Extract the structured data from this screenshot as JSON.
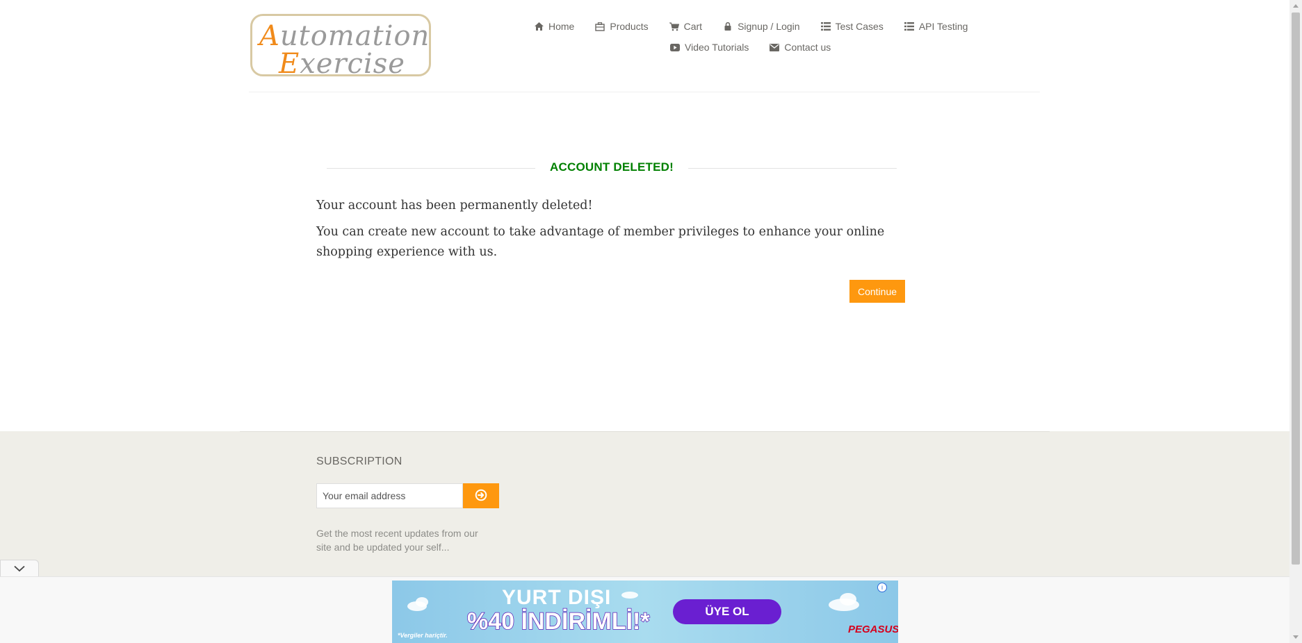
{
  "brand": {
    "logo_line1_cap": "A",
    "logo_line1_rest": "utomation",
    "logo_line2_cap": "E",
    "logo_line2_rest": "xercise",
    "accent_color": "#fe980f",
    "success_color": "#008000"
  },
  "nav": {
    "items": [
      {
        "label": "Home",
        "icon": "home-icon"
      },
      {
        "label": "Products",
        "icon": "products-icon"
      },
      {
        "label": "Cart",
        "icon": "cart-icon"
      },
      {
        "label": "Signup / Login",
        "icon": "lock-icon"
      },
      {
        "label": "Test Cases",
        "icon": "list-icon"
      },
      {
        "label": "API Testing",
        "icon": "list-icon"
      },
      {
        "label": "Video Tutorials",
        "icon": "youtube-play-icon"
      },
      {
        "label": "Contact us",
        "icon": "envelope-icon"
      }
    ]
  },
  "main": {
    "title": "ACCOUNT DELETED!",
    "message1": "Your account has been permanently deleted!",
    "message2": "You can create new account to take advantage of member privileges to enhance your online shopping experience with us.",
    "continue_label": "Continue"
  },
  "footer": {
    "subscription_title": "SUBSCRIPTION",
    "email_placeholder": "Your email address",
    "description": "Get the most recent updates from our site and be updated your self..."
  },
  "ad": {
    "headline": "YURT DIŞI",
    "offer": "%40 İNDİRİMLİ!*",
    "cta": "ÜYE OL",
    "note": "*Vergiler hariçtir.",
    "brand": "PEGASUS",
    "info": "i"
  }
}
